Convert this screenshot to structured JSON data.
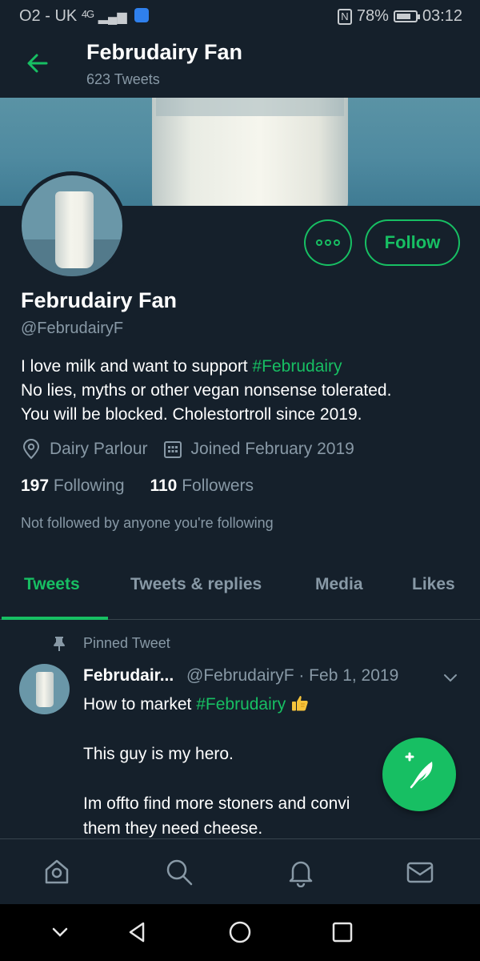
{
  "status_bar": {
    "carrier": "O2 - UK",
    "network": "4G",
    "battery_percent": "78%",
    "battery_level": 0.78,
    "time": "03:12"
  },
  "header": {
    "title": "Februdairy Fan",
    "tweet_count": "623 Tweets"
  },
  "actions": {
    "follow_label": "Follow"
  },
  "profile": {
    "name": "Februdairy Fan",
    "handle": "@FebrudairyF",
    "bio_line1_prefix": "I love milk and want to support ",
    "bio_line1_hashtag": "#Februdairy",
    "bio_line2": "No lies, myths or other vegan nonsense tolerated.",
    "bio_line3": "You will be blocked. Cholestortroll since 2019.",
    "location": "Dairy Parlour",
    "joined": "Joined February 2019",
    "following_count": "197",
    "following_label": "Following",
    "followers_count": "110",
    "followers_label": "Followers",
    "not_followed": "Not followed by anyone you're following"
  },
  "tabs": [
    {
      "label": "Tweets",
      "active": true
    },
    {
      "label": "Tweets & replies",
      "active": false
    },
    {
      "label": "Media",
      "active": false
    },
    {
      "label": "Likes",
      "active": false
    }
  ],
  "pinned_tweet": {
    "pinned_label": "Pinned Tweet",
    "author": "Februdair...",
    "meta": "@FebrudairyF · Feb 1, 2019",
    "line1_prefix": "How to market ",
    "line1_hashtag": "#Februdairy",
    "line2": "This guy is my hero.",
    "line3": "Im offto find more stoners and convi",
    "line4": "them they need cheese."
  },
  "colors": {
    "background": "#15202b",
    "accent": "#17bf63",
    "secondary_text": "#8899a6",
    "divider": "#38444d"
  },
  "icons": {
    "back": "arrow-left-icon",
    "more": "more-options-icon",
    "location": "location-pin-icon",
    "calendar": "calendar-icon",
    "pin": "pin-icon",
    "chevron": "chevron-down-icon",
    "thumbs_up": "thumbs-up-emoji-icon",
    "compose": "compose-tweet-icon",
    "home": "home-icon",
    "search": "search-icon",
    "notifications": "bell-icon",
    "messages": "mail-icon",
    "sys_down": "chevron-down-icon",
    "sys_back": "triangle-back-icon",
    "sys_home": "circle-home-icon",
    "sys_recents": "square-recents-icon"
  }
}
